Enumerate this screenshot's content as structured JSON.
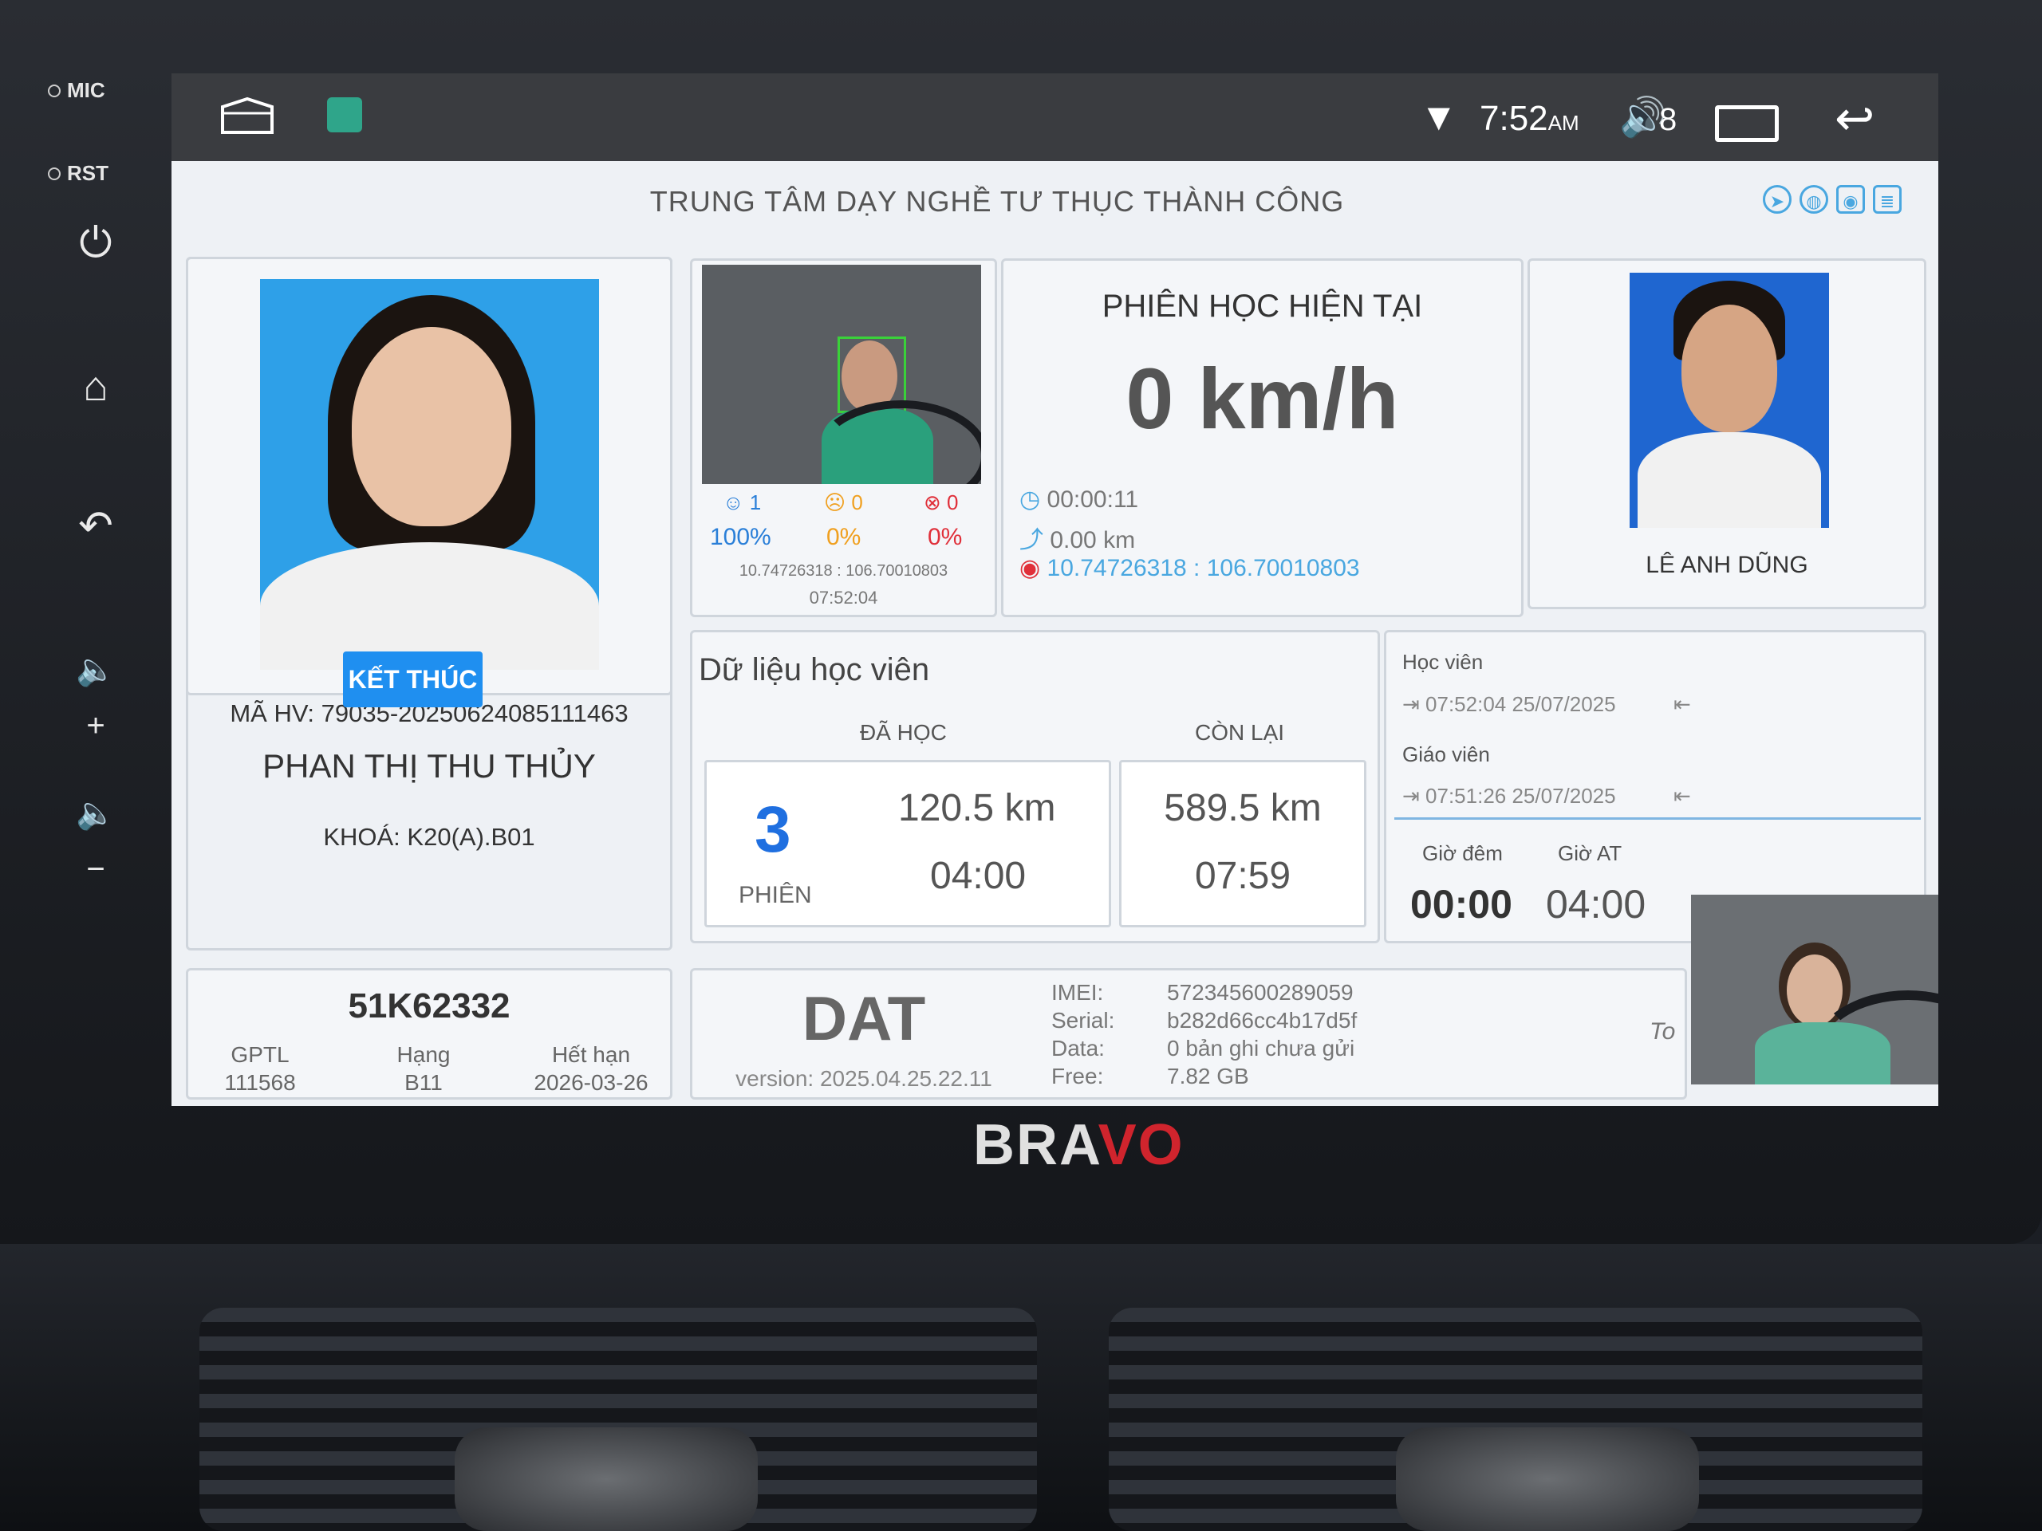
{
  "bezel": {
    "mic_label": "MIC",
    "rst_label": "RST",
    "brand": "BRAVO"
  },
  "statusbar": {
    "time": "7:52",
    "ampm": "AM",
    "volume": "8"
  },
  "header": {
    "title": "TRUNG TÂM DẠY NGHỀ TƯ THỤC THÀNH CÔNG"
  },
  "student": {
    "code": "MÃ HV: 79035-20250624085111463",
    "name": "PHAN THỊ THU THỦY",
    "course": "KHOÁ: K20(A).B01",
    "end_button": "KẾT THÚC"
  },
  "camera": {
    "stats": [
      {
        "count": "1",
        "percent": "100%",
        "color": "#2a7fd8"
      },
      {
        "count": "0",
        "percent": "0%",
        "color": "#f0a020"
      },
      {
        "count": "0",
        "percent": "0%",
        "color": "#e0303a"
      }
    ],
    "coords": "10.74726318 : 106.70010803",
    "time": "07:52:04"
  },
  "session": {
    "title": "PHIÊN HỌC HIỆN TẠI",
    "speed": "0 km/h",
    "duration": "00:00:11",
    "distance": "0.00 km",
    "gps": "10.74726318 : 106.70010803"
  },
  "teacher": {
    "name": "LÊ ANH DŨNG"
  },
  "student_data": {
    "title": "Dữ liệu học viên",
    "done_label": "ĐÃ HỌC",
    "remain_label": "CÒN LẠI",
    "sessions": "3",
    "sessions_label": "PHIÊN",
    "done_km": "120.5 km",
    "done_time": "04:00",
    "remain_km": "589.5 km",
    "remain_time": "07:59"
  },
  "login": {
    "student_label": "Học viên",
    "student_time": "07:52:04 25/07/2025",
    "teacher_label": "Giáo viên",
    "teacher_time": "07:51:26 25/07/2025",
    "night_label": "Giờ đêm",
    "night_value": "00:00",
    "at_label": "Giờ AT",
    "at_value": "04:00"
  },
  "vehicle": {
    "plate": "51K62332",
    "gptl_label": "GPTL",
    "gptl_value": "111568",
    "class_label": "Hạng",
    "class_value": "B11",
    "expiry_label": "Hết hạn",
    "expiry_value": "2026-03-26"
  },
  "device": {
    "name": "DAT",
    "version": "version: 2025.04.25.22.11",
    "imei_label": "IMEI:",
    "imei_value": "572345600289059",
    "serial_label": "Serial:",
    "serial_value": "b282d66cc4b17d5f",
    "data_label": "Data:",
    "data_value": "0 bản ghi chưa gửi",
    "free_label": "Free:",
    "free_value": "7.82 GB",
    "overflow_text": "To"
  }
}
